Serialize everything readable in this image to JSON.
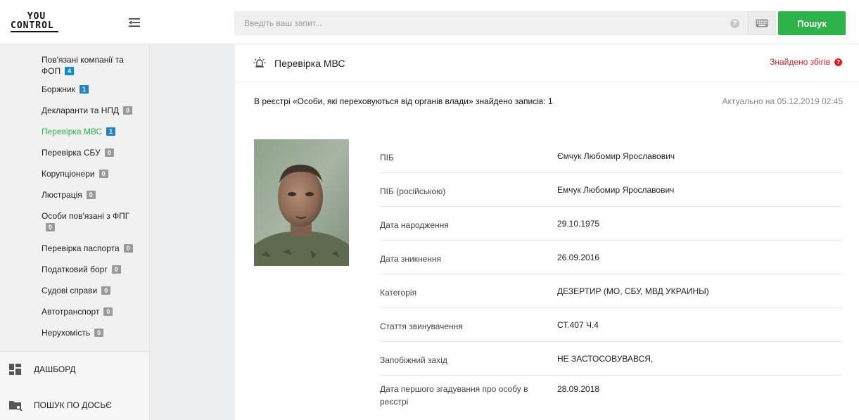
{
  "logo": {
    "line1": "YOU",
    "line2": "CONTROL"
  },
  "sidebar": {
    "items": [
      {
        "label": "Пов'язані компанії та ФОП",
        "count": "4",
        "badge": "blue",
        "active": false
      },
      {
        "label": "Боржник",
        "count": "1",
        "badge": "blue",
        "active": false
      },
      {
        "label": "Декларанти та НПД",
        "count": "0",
        "badge": "gray",
        "active": false
      },
      {
        "label": "Перевірка МВС",
        "count": "1",
        "badge": "blue",
        "active": true
      },
      {
        "label": "Перевірка СБУ",
        "count": "0",
        "badge": "gray",
        "active": false
      },
      {
        "label": "Корупціонери",
        "count": "0",
        "badge": "gray",
        "active": false
      },
      {
        "label": "Люстрація",
        "count": "0",
        "badge": "gray",
        "active": false
      },
      {
        "label": "Особи пов'язані з ФПГ",
        "count": "0",
        "badge": "gray",
        "active": false
      },
      {
        "label": "Перевірка паспорта",
        "count": "0",
        "badge": "gray",
        "active": false
      },
      {
        "label": "Податковий борг",
        "count": "0",
        "badge": "gray",
        "active": false
      },
      {
        "label": "Судові справи",
        "count": "0",
        "badge": "gray",
        "active": false
      },
      {
        "label": "Автотранспорт",
        "count": "0",
        "badge": "gray",
        "active": false
      },
      {
        "label": "Нерухомість",
        "count": "0",
        "badge": "gray",
        "active": false
      }
    ],
    "bottom": {
      "dashboard": "ДАШБОРД",
      "dossier_search": "ПОШУК ПО ДОСЬЄ"
    }
  },
  "header": {
    "search_placeholder": "Введіть ваш запит...",
    "help_glyph": "?",
    "search_button": "Пошук"
  },
  "panel": {
    "title": "Перевірка МВС",
    "found_label": "Знайдено збігів",
    "registry_text": "В реєстрі «Особи, які переховуються від органів влади» знайдено записів: 1",
    "actual_text": "Актуально на 05.12.2019 02:45"
  },
  "details": [
    {
      "label": "ПІБ",
      "value": "Ємчук Любомир Ярославович"
    },
    {
      "label": "ПІБ (російською)",
      "value": "Емчук Любомир Ярославович"
    },
    {
      "label": "Дата народження",
      "value": "29.10.1975"
    },
    {
      "label": "Дата зникнення",
      "value": "26.09.2016"
    },
    {
      "label": "Категорія",
      "value": "ДЕЗЕРТИР (МО, СБУ, МВД УКРАИНЫ)"
    },
    {
      "label": "Стаття звинувачення",
      "value": "СТ.407 Ч.4"
    },
    {
      "label": "Запобіжний захід",
      "value": "НЕ ЗАСТОСОВУВАВСЯ,"
    },
    {
      "label": "Дата першого згадування про особу в реєстрі",
      "value": "28.09.2018"
    }
  ],
  "colors": {
    "accent_green": "#2eb24a",
    "badge_blue": "#1b87c9",
    "badge_gray": "#9a9a9a",
    "alert_red": "#c0262e"
  }
}
